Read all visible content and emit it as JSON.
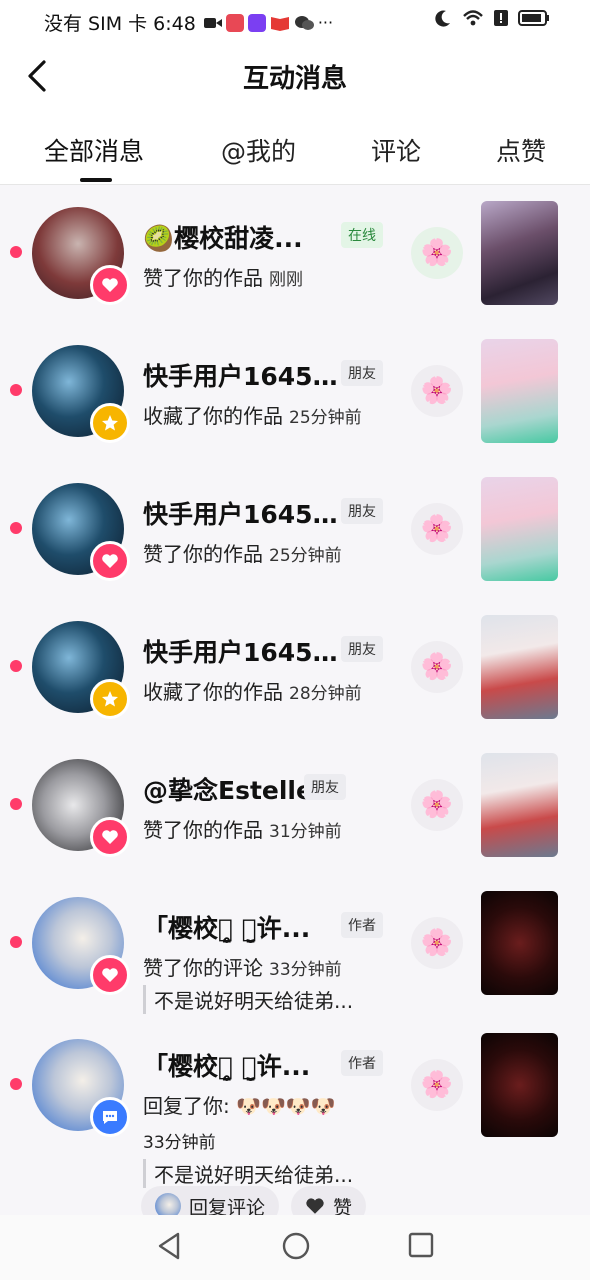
{
  "status": {
    "carrier_time": "没有 SIM 卡 6:48",
    "icons": [
      "video-icon",
      "app-icon",
      "app-icon",
      "book-icon",
      "wechat-icon",
      "more-icon"
    ],
    "right_icons": [
      "moon-icon",
      "wifi-icon",
      "alert-icon",
      "battery-icon"
    ]
  },
  "header": {
    "title": "互动消息"
  },
  "tabs": [
    {
      "label": "全部消息"
    },
    {
      "label": "@我的"
    },
    {
      "label": "评论"
    },
    {
      "label": "点赞"
    }
  ],
  "messages": [
    {
      "name": "🥝樱校甜凌...",
      "tag": "在线",
      "action": "赞了你的作品",
      "time": "刚刚"
    },
    {
      "name": "快手用户1645...",
      "tag": "朋友",
      "action": "收藏了你的作品",
      "time": "25分钟前"
    },
    {
      "name": "快手用户1645...",
      "tag": "朋友",
      "action": "赞了你的作品",
      "time": "25分钟前"
    },
    {
      "name": "快手用户1645...",
      "tag": "朋友",
      "action": "收藏了你的作品",
      "time": "28分钟前"
    },
    {
      "name": "@挚念Estelle",
      "tag": "朋友",
      "action": "赞了你的作品",
      "time": "31分钟前"
    },
    {
      "name": "「樱校ꪔ̤̥ ꪔ̤̮许...",
      "tag": "作者",
      "action": "赞了你的评论",
      "time": "33分钟前",
      "quote": "不是说好明天给徒弟..."
    },
    {
      "name": "「樱校ꪔ̤̥ ꪔ̤̮许...",
      "tag": "作者",
      "action": "回复了你: 🐶🐶🐶🐶",
      "time": "33分钟前",
      "quote": "不是说好明天给徒弟..."
    }
  ],
  "actions": {
    "reply_label": "回复评论",
    "like_label": "赞"
  },
  "colors": {
    "accent_red": "#ff3b6a",
    "star_yellow": "#f7b500",
    "reply_blue": "#3a7bff",
    "online_green": "#2b8a3e"
  }
}
